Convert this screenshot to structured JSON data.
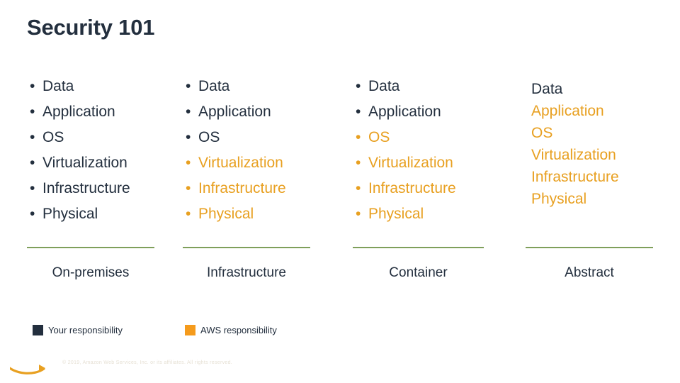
{
  "slide": {
    "title": "Security 101"
  },
  "colors": {
    "dark": "#232f3e",
    "orange": "#e8a021",
    "green_rule": "#7f9f5b",
    "legend_your": "#232f3e",
    "legend_aws": "#f59b1c",
    "background": "#ffffff"
  },
  "columns": [
    {
      "name": "on-premises",
      "footer_label": "On-premises",
      "bulleted": true,
      "items": [
        {
          "label": "Data",
          "owner": "your"
        },
        {
          "label": "Application",
          "owner": "your"
        },
        {
          "label": "OS",
          "owner": "your"
        },
        {
          "label": "Virtualization",
          "owner": "your"
        },
        {
          "label": "Infrastructure",
          "owner": "your"
        },
        {
          "label": "Physical",
          "owner": "your"
        }
      ]
    },
    {
      "name": "infrastructure",
      "footer_label": "Infrastructure",
      "bulleted": true,
      "items": [
        {
          "label": "Data",
          "owner": "your"
        },
        {
          "label": "Application",
          "owner": "your"
        },
        {
          "label": "OS",
          "owner": "your"
        },
        {
          "label": "Virtualization",
          "owner": "aws"
        },
        {
          "label": "Infrastructure",
          "owner": "aws"
        },
        {
          "label": "Physical",
          "owner": "aws"
        }
      ]
    },
    {
      "name": "container",
      "footer_label": "Container",
      "bulleted": true,
      "items": [
        {
          "label": "Data",
          "owner": "your"
        },
        {
          "label": "Application",
          "owner": "your"
        },
        {
          "label": "OS",
          "owner": "aws"
        },
        {
          "label": "Virtualization",
          "owner": "aws"
        },
        {
          "label": "Infrastructure",
          "owner": "aws"
        },
        {
          "label": "Physical",
          "owner": "aws"
        }
      ]
    },
    {
      "name": "abstract",
      "footer_label": "Abstract",
      "bulleted": false,
      "items": [
        {
          "label": "Data",
          "owner": "your"
        },
        {
          "label": "Application",
          "owner": "aws"
        },
        {
          "label": "OS",
          "owner": "aws"
        },
        {
          "label": "Virtualization",
          "owner": "aws"
        },
        {
          "label": "Infrastructure",
          "owner": "aws"
        },
        {
          "label": "Physical",
          "owner": "aws"
        }
      ]
    }
  ],
  "legend": [
    {
      "label": "Your responsibility",
      "color": "#232f3e"
    },
    {
      "label": "AWS responsibility",
      "color": "#f59b1c"
    }
  ],
  "bullet_glyph": "•",
  "footer": {
    "copyright": "© 2019, Amazon Web Services, Inc. or its affiliates. All rights reserved."
  }
}
